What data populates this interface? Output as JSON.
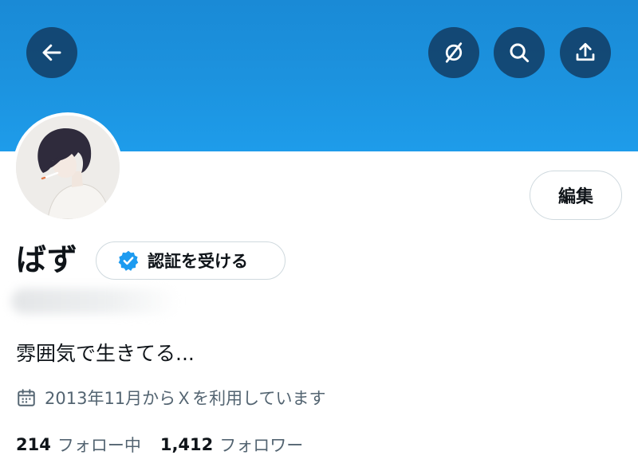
{
  "header": {
    "icons": [
      "back-arrow-icon",
      "grok-icon",
      "search-icon",
      "share-icon"
    ]
  },
  "profile": {
    "display_name": "ばず",
    "verify_label": "認証を受ける",
    "edit_label": "編集",
    "bio": "雰囲気で生きてる...",
    "joined": "2013年11月からＸを利用しています",
    "following_count": "214",
    "following_label": "フォロー中",
    "followers_count": "1,412",
    "followers_label": "フォロワー"
  },
  "colors": {
    "banner": "#1c93df",
    "verify_badge": "#1d9bf0",
    "secondary_text": "#536471",
    "primary_text": "#0f1419"
  }
}
